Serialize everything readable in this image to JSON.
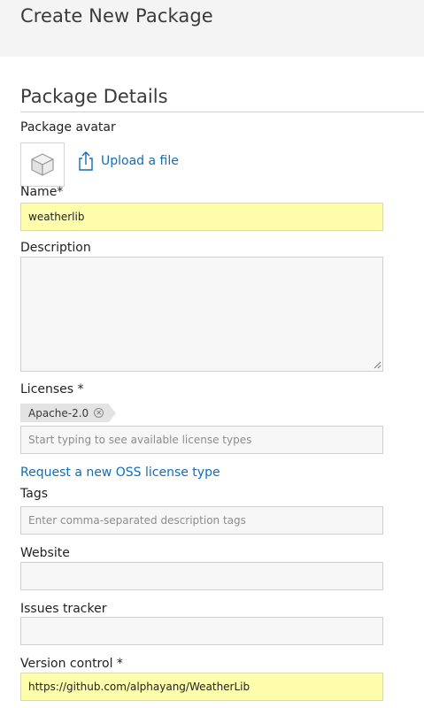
{
  "header": {
    "title": "Create New Package"
  },
  "section": {
    "title": "Package Details"
  },
  "avatar": {
    "label": "Package avatar",
    "upload_label": "Upload a file",
    "icon": "cube-icon"
  },
  "name": {
    "label": "Name*",
    "value": "weatherlib"
  },
  "description": {
    "label": "Description",
    "value": ""
  },
  "licenses": {
    "label": "Licenses *",
    "selected": [
      "Apache-2.0"
    ],
    "placeholder": "Start typing to see available license types",
    "request_link": "Request a new OSS license type"
  },
  "tags": {
    "label": "Tags",
    "placeholder": "Enter comma-separated description tags"
  },
  "website": {
    "label": "Website",
    "value": ""
  },
  "issues": {
    "label": "Issues tracker",
    "value": ""
  },
  "vcs": {
    "label": "Version control *",
    "value": "https://github.com/alphayang/WeatherLib"
  },
  "colors": {
    "link": "#0f6dba",
    "highlight": "#fdfdab",
    "header_bg": "#f4f4f4"
  }
}
